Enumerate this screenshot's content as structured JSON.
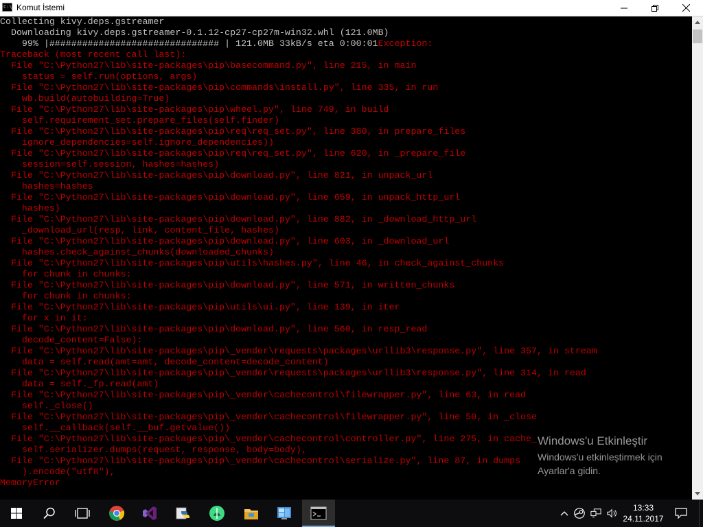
{
  "window": {
    "title": "Komut İstemi",
    "icon_text": "C:\\"
  },
  "console": {
    "lines": [
      {
        "text": "Collecting kivy.deps.gstreamer",
        "color": "white"
      },
      {
        "text": "  Downloading kivy.deps.gstreamer-0.1.12-cp27-cp27m-win32.whl (121.0MB)",
        "color": "white"
      },
      {
        "text": "    99% |############################### | 121.0MB 33kB/s eta 0:00:01",
        "color": "white",
        "suffix": "Exception:"
      },
      {
        "text": "Traceback (most recent call last):",
        "color": "red"
      },
      {
        "text": "  File \"C:\\Python27\\lib\\site-packages\\pip\\basecommand.py\", line 215, in main",
        "color": "red"
      },
      {
        "text": "    status = self.run(options, args)",
        "color": "red"
      },
      {
        "text": "  File \"C:\\Python27\\lib\\site-packages\\pip\\commands\\install.py\", line 335, in run",
        "color": "red"
      },
      {
        "text": "    wb.build(autobuilding=True)",
        "color": "red"
      },
      {
        "text": "  File \"C:\\Python27\\lib\\site-packages\\pip\\wheel.py\", line 749, in build",
        "color": "red"
      },
      {
        "text": "    self.requirement_set.prepare_files(self.finder)",
        "color": "red"
      },
      {
        "text": "  File \"C:\\Python27\\lib\\site-packages\\pip\\req\\req_set.py\", line 380, in prepare_files",
        "color": "red"
      },
      {
        "text": "    ignore_dependencies=self.ignore_dependencies))",
        "color": "red"
      },
      {
        "text": "  File \"C:\\Python27\\lib\\site-packages\\pip\\req\\req_set.py\", line 620, in _prepare_file",
        "color": "red"
      },
      {
        "text": "    session=self.session, hashes=hashes)",
        "color": "red"
      },
      {
        "text": "  File \"C:\\Python27\\lib\\site-packages\\pip\\download.py\", line 821, in unpack_url",
        "color": "red"
      },
      {
        "text": "    hashes=hashes",
        "color": "red"
      },
      {
        "text": "  File \"C:\\Python27\\lib\\site-packages\\pip\\download.py\", line 659, in unpack_http_url",
        "color": "red"
      },
      {
        "text": "    hashes)",
        "color": "red"
      },
      {
        "text": "  File \"C:\\Python27\\lib\\site-packages\\pip\\download.py\", line 882, in _download_http_url",
        "color": "red"
      },
      {
        "text": "    _download_url(resp, link, content_file, hashes)",
        "color": "red"
      },
      {
        "text": "  File \"C:\\Python27\\lib\\site-packages\\pip\\download.py\", line 603, in _download_url",
        "color": "red"
      },
      {
        "text": "    hashes.check_against_chunks(downloaded_chunks)",
        "color": "red"
      },
      {
        "text": "  File \"C:\\Python27\\lib\\site-packages\\pip\\utils\\hashes.py\", line 46, in check_against_chunks",
        "color": "red"
      },
      {
        "text": "    for chunk in chunks:",
        "color": "red"
      },
      {
        "text": "  File \"C:\\Python27\\lib\\site-packages\\pip\\download.py\", line 571, in written_chunks",
        "color": "red"
      },
      {
        "text": "    for chunk in chunks:",
        "color": "red"
      },
      {
        "text": "  File \"C:\\Python27\\lib\\site-packages\\pip\\utils\\ui.py\", line 139, in iter",
        "color": "red"
      },
      {
        "text": "    for x in it:",
        "color": "red"
      },
      {
        "text": "  File \"C:\\Python27\\lib\\site-packages\\pip\\download.py\", line 560, in resp_read",
        "color": "red"
      },
      {
        "text": "    decode_content=False):",
        "color": "red"
      },
      {
        "text": "  File \"C:\\Python27\\lib\\site-packages\\pip\\_vendor\\requests\\packages\\urllib3\\response.py\", line 357, in stream",
        "color": "red"
      },
      {
        "text": "    data = self.read(amt=amt, decode_content=decode_content)",
        "color": "red"
      },
      {
        "text": "  File \"C:\\Python27\\lib\\site-packages\\pip\\_vendor\\requests\\packages\\urllib3\\response.py\", line 314, in read",
        "color": "red"
      },
      {
        "text": "    data = self._fp.read(amt)",
        "color": "red"
      },
      {
        "text": "  File \"C:\\Python27\\lib\\site-packages\\pip\\_vendor\\cachecontrol\\filewrapper.py\", line 63, in read",
        "color": "red"
      },
      {
        "text": "    self._close()",
        "color": "red"
      },
      {
        "text": "  File \"C:\\Python27\\lib\\site-packages\\pip\\_vendor\\cachecontrol\\filewrapper.py\", line 50, in _close",
        "color": "red"
      },
      {
        "text": "    self.__callback(self.__buf.getvalue())",
        "color": "red"
      },
      {
        "text": "  File \"C:\\Python27\\lib\\site-packages\\pip\\_vendor\\cachecontrol\\controller.py\", line 275, in cache_",
        "color": "red"
      },
      {
        "text": "    self.serializer.dumps(request, response, body=body),",
        "color": "red"
      },
      {
        "text": "  File \"C:\\Python27\\lib\\site-packages\\pip\\_vendor\\cachecontrol\\serialize.py\", line 87, in dumps",
        "color": "red"
      },
      {
        "text": "    ).encode(\"utf8\"),",
        "color": "red"
      },
      {
        "text": "MemoryError",
        "color": "red"
      }
    ]
  },
  "watermark": {
    "title": "Windows'u Etkinleştir",
    "line1": "Windows'u etkinleştirmek için",
    "line2": "Ayarlar'a gidin."
  },
  "taskbar": {
    "apps": [
      {
        "name": "start-icon"
      },
      {
        "name": "search-icon"
      },
      {
        "name": "task-view-icon"
      },
      {
        "name": "chrome-icon"
      },
      {
        "name": "visual-studio-icon"
      },
      {
        "name": "python-icon"
      },
      {
        "name": "android-studio-icon"
      },
      {
        "name": "file-explorer-icon"
      },
      {
        "name": "control-panel-icon"
      },
      {
        "name": "command-prompt-icon"
      }
    ],
    "clock_time": "13:33",
    "clock_date": "24.11.2017"
  },
  "colors": {
    "console_fg": "#c0c0c0",
    "error_red": "#c00000",
    "taskbar_bg": "#0d0d0f",
    "accent": "#7aa7d6"
  }
}
